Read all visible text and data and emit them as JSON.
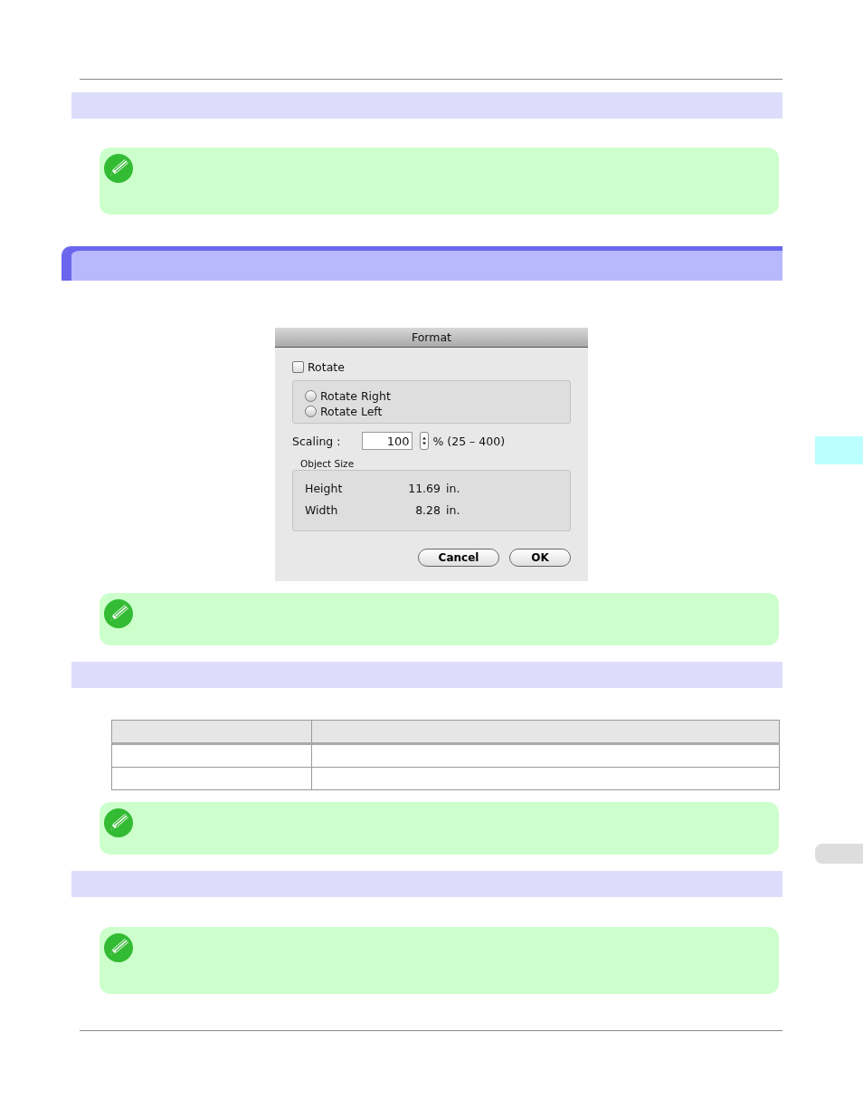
{
  "dialog": {
    "title": "Format",
    "rotate": {
      "label": "Rotate",
      "checked": false
    },
    "rotate_options": [
      {
        "label": "Rotate Right",
        "selected": false
      },
      {
        "label": "Rotate Left",
        "selected": false
      }
    ],
    "scaling": {
      "label": "Scaling :",
      "value": "100",
      "range": "% (25 – 400)"
    },
    "object_size": {
      "title": "Object Size",
      "rows": [
        {
          "label": "Height",
          "value": "11.69",
          "unit": "in."
        },
        {
          "label": "Width",
          "value": "8.28",
          "unit": "in."
        }
      ]
    },
    "buttons": [
      "Cancel",
      "OK"
    ]
  },
  "side_tabs": [
    {
      "selected": true
    },
    {
      "selected": false
    }
  ]
}
